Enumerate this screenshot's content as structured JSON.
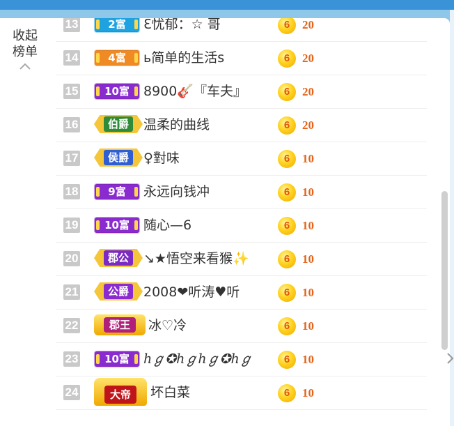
{
  "collapse": {
    "line1": "收起",
    "line2": "榜单"
  },
  "coin_label": "6",
  "rows": [
    {
      "rank": "13",
      "badge": "2富",
      "badge_type": "fu",
      "badge_color": "#1ea2e0",
      "name": "ℇ忧郁：☆ 哥",
      "amount": "20"
    },
    {
      "rank": "14",
      "badge": "4富",
      "badge_type": "fu",
      "badge_color": "#f08a24",
      "name": "ь简单的生活s",
      "amount": "20"
    },
    {
      "rank": "15",
      "badge": "10富",
      "badge_type": "fu",
      "badge_color": "#8a2bd0",
      "name": "8900🎸『车夫』",
      "amount": "20"
    },
    {
      "rank": "16",
      "badge": "伯爵",
      "badge_type": "noble",
      "badge_color": "#2e8b3a",
      "name": "温柔的曲线",
      "amount": "20"
    },
    {
      "rank": "17",
      "badge": "侯爵",
      "badge_type": "noble",
      "badge_color": "#2f5fd0",
      "name": "♀對味",
      "amount": "10"
    },
    {
      "rank": "18",
      "badge": "9富",
      "badge_type": "fu",
      "badge_color": "#8a2bd0",
      "name": "永远向钱冲",
      "amount": "10"
    },
    {
      "rank": "19",
      "badge": "10富",
      "badge_type": "fu",
      "badge_color": "#8a2bd0",
      "name": "随心—6",
      "amount": "10"
    },
    {
      "rank": "20",
      "badge": "郡公",
      "badge_type": "noble",
      "badge_color": "#7b2bc4",
      "name": "↘★悟空来看猴✨",
      "amount": "10"
    },
    {
      "rank": "21",
      "badge": "公爵",
      "badge_type": "noble",
      "badge_color": "#8a2bd0",
      "name": "2008❤听涛♥听",
      "amount": "10"
    },
    {
      "rank": "22",
      "badge": "郡王",
      "badge_type": "king",
      "badge_color": "#b0207a",
      "name": "冰♡冷",
      "amount": "10"
    },
    {
      "rank": "23",
      "badge": "10富",
      "badge_type": "fu",
      "badge_color": "#8a2bd0",
      "name": "ℎℊ✪ℎℊℎℊ✪ℎℊ",
      "amount": "10"
    },
    {
      "rank": "24",
      "badge": "大帝",
      "badge_type": "emperor",
      "badge_color": "#c0141b",
      "name": "坏白菜",
      "amount": "10"
    }
  ]
}
